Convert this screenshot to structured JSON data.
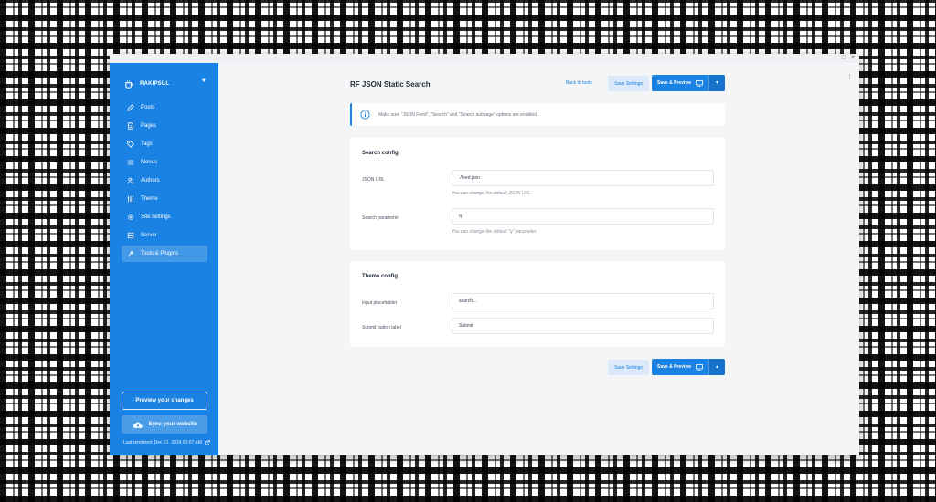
{
  "window": {
    "controls": [
      "–",
      "□",
      "✕"
    ]
  },
  "sidebar": {
    "site_name": "RAKIPSUL",
    "items": [
      {
        "label": "Posts",
        "icon": "pencil-icon"
      },
      {
        "label": "Pages",
        "icon": "document-icon"
      },
      {
        "label": "Tags",
        "icon": "tag-icon"
      },
      {
        "label": "Menus",
        "icon": "menu-icon"
      },
      {
        "label": "Authors",
        "icon": "users-icon"
      },
      {
        "label": "Theme",
        "icon": "theme-icon"
      },
      {
        "label": "Site settings",
        "icon": "gear-icon"
      },
      {
        "label": "Server",
        "icon": "server-icon"
      },
      {
        "label": "Tools & Plugins",
        "icon": "wrench-icon",
        "active": true
      }
    ],
    "preview_label": "Preview your changes",
    "sync_label": "Sync your website",
    "last_rendered": "Last rendered: Dec 21, 2024 03:07 AM"
  },
  "header": {
    "title": "RF JSON Static Search",
    "back_label": "Back to tools",
    "save_label": "Save Settings",
    "save_preview_label": "Save & Preview"
  },
  "notice": {
    "text": "Make sure \"JSON Feed\", \"Search\" and \"Search subpage\" options are enabled."
  },
  "search_config": {
    "title": "Search config",
    "json_url_label": "JSON URL",
    "json_url_value": "./feed.json",
    "json_url_help": "You can change the default JSON URL.",
    "param_label": "Search parameter",
    "param_value": "q",
    "param_help": "You can change the default \"q\" parameter."
  },
  "theme_config": {
    "title": "Theme config",
    "placeholder_label": "Input placeholder",
    "placeholder_value": "search...",
    "submit_label": "Submit button label",
    "submit_value": "Submit"
  },
  "footer": {
    "save_label": "Save Settings",
    "save_preview_label": "Save & Preview"
  },
  "colors": {
    "accent": "#1a82e2",
    "background": "#f4f5f7"
  }
}
